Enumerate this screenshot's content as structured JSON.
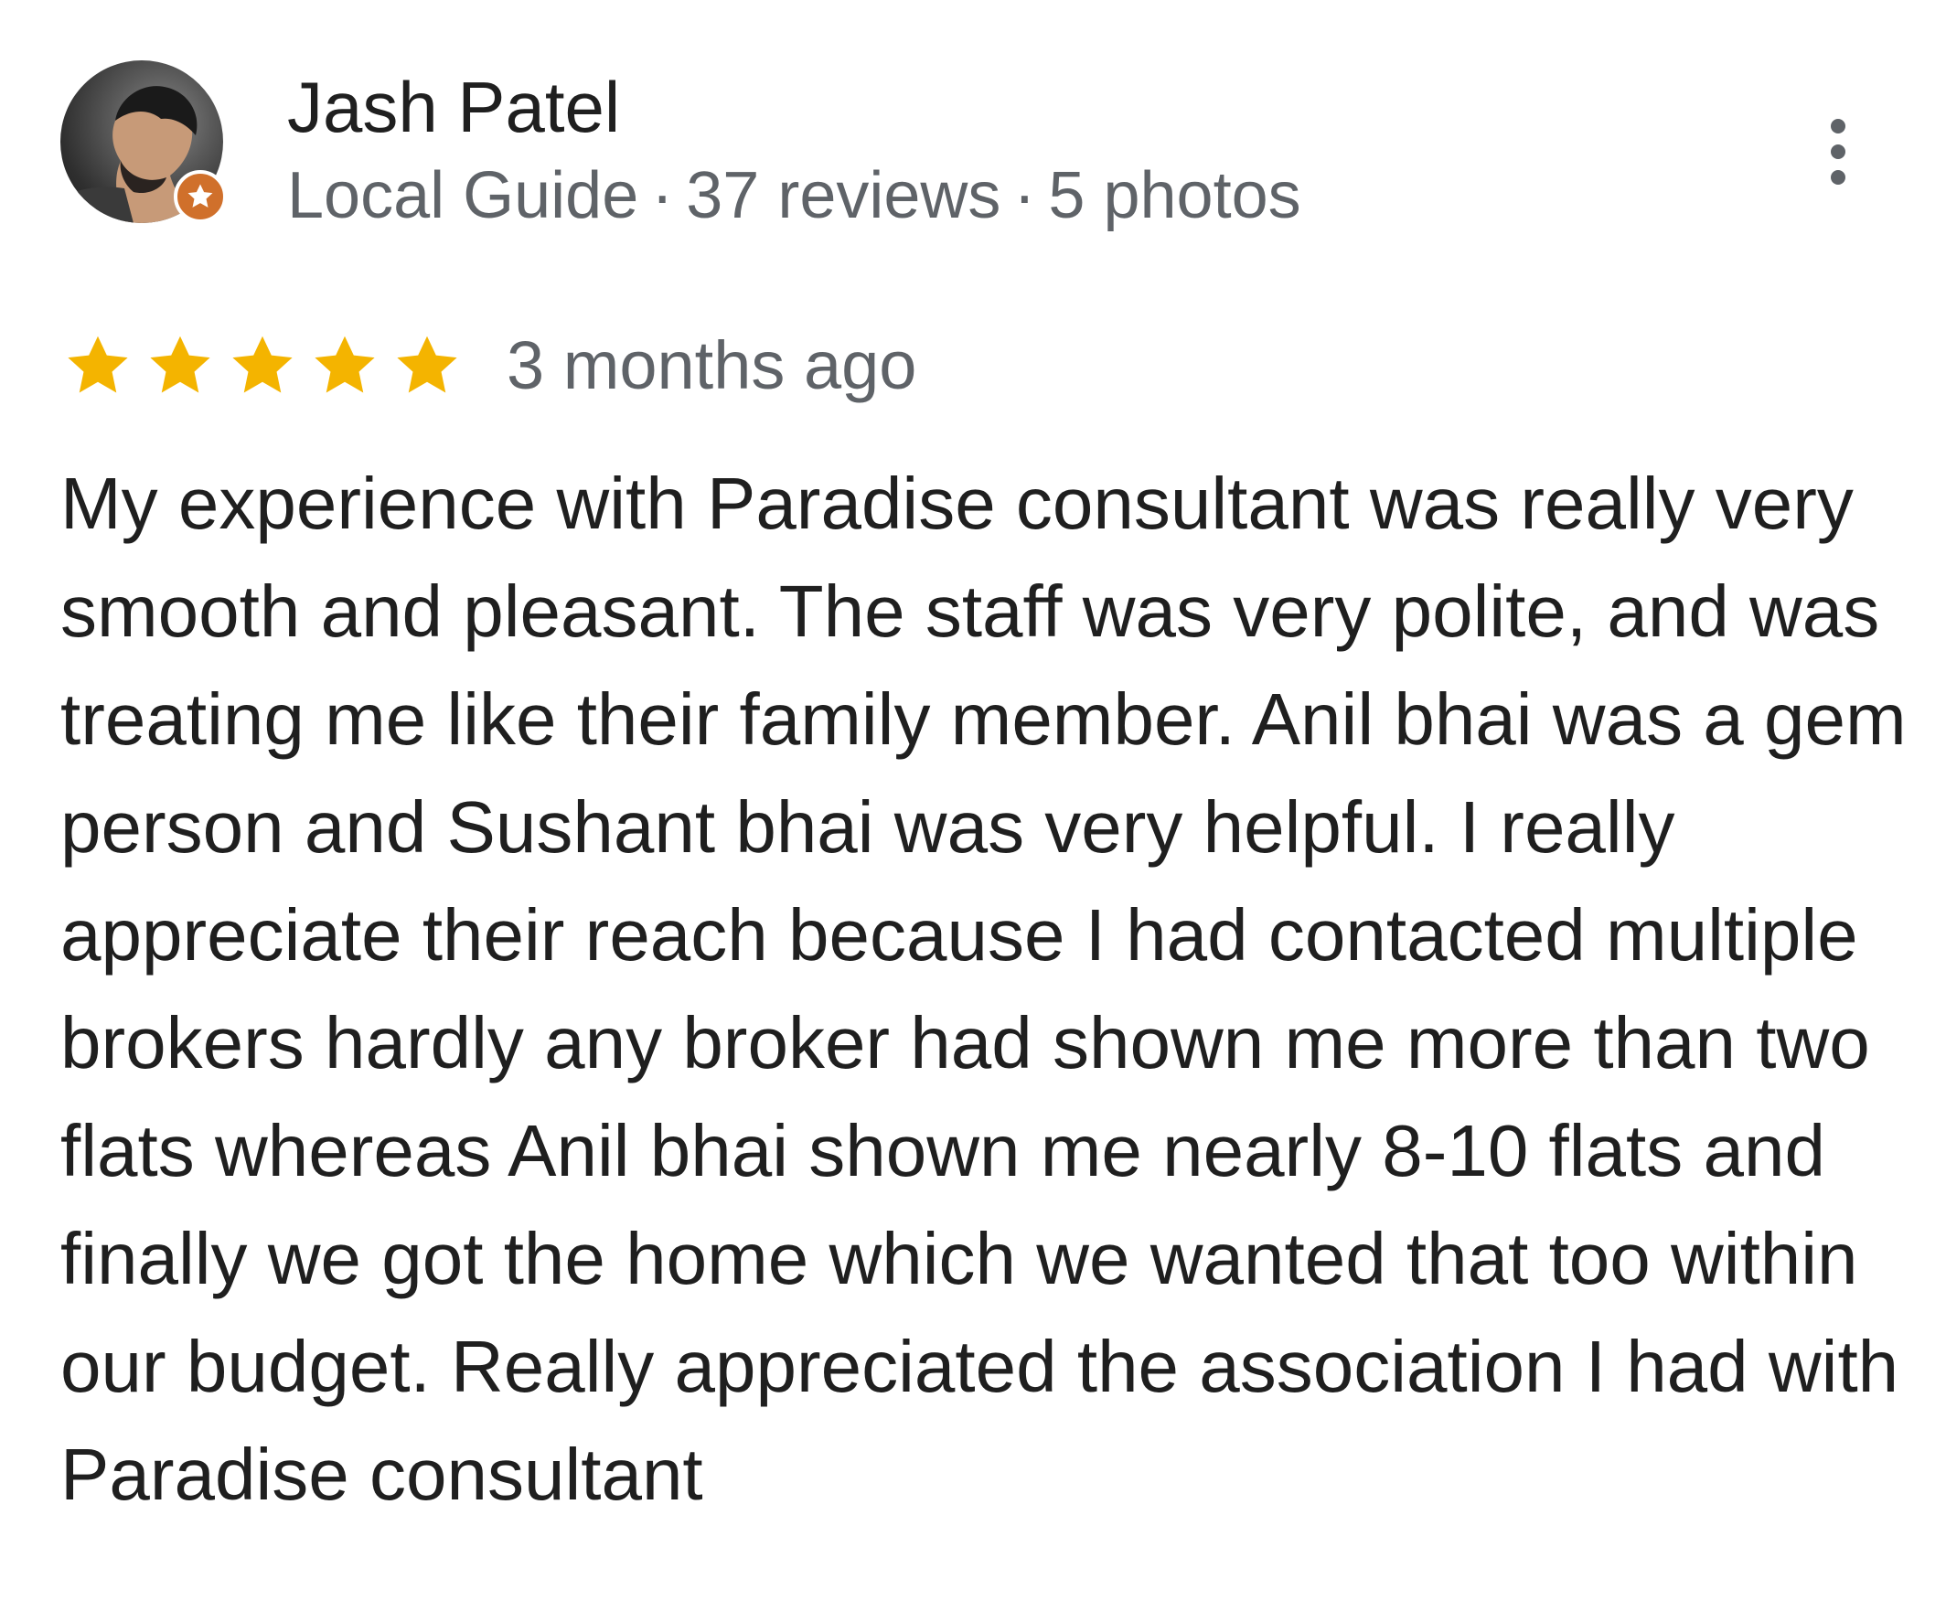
{
  "review": {
    "author": {
      "name": "Jash Patel",
      "badge_label": "Local Guide",
      "reviews_count": "37 reviews",
      "photos_count": "5 photos",
      "separator": "·",
      "avatar_icon": "user-avatar-photo",
      "badge_icon": "local-guide-star-badge"
    },
    "menu_icon": "more-vertical-icon",
    "rating": {
      "stars": 5,
      "max_stars": 5,
      "star_color": "#f4b400",
      "time": "3 months ago"
    },
    "text": "My experience with Paradise consultant was really very smooth and pleasant. The staff was very polite, and was treating me like their family member. Anil bhai was a gem person and Sushant bhai was very helpful. I really appreciate their reach because I had contacted multiple brokers hardly any broker had shown me more than two flats whereas Anil bhai shown me nearly 8-10 flats and finally we got the home which we wanted that too within our budget. Really appreciated the association I had with Paradise consultant"
  },
  "colors": {
    "primary_text": "#1f1f1f",
    "secondary_text": "#5f6368",
    "badge": "#d0702b"
  }
}
